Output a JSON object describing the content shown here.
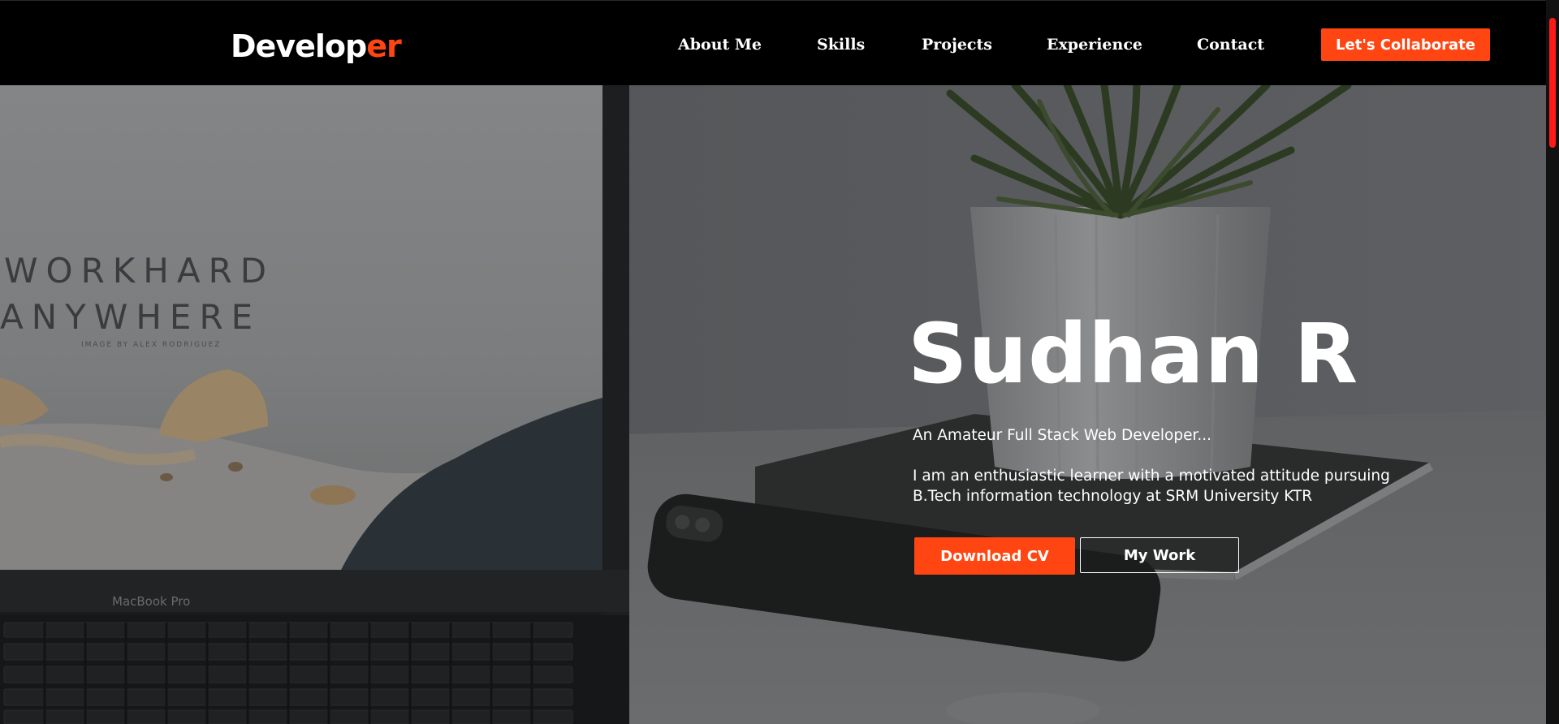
{
  "navbar": {
    "brand_main": "Develop",
    "brand_accent": "er",
    "links": [
      "About Me",
      "Skills",
      "Projects",
      "Experience",
      "Contact"
    ],
    "cta_label": "Let's Collaborate"
  },
  "hero": {
    "title": "Sudhan R",
    "tagline": "An Amateur Full Stack Web Developer...",
    "description": "I am an enthusiastic learner with a motivated attitude pursuing B.Tech information technology at SRM University KTR",
    "primary_button": "Download CV",
    "secondary_button": "My Work",
    "background_image": {
      "screen_line1": "WORKHARD",
      "screen_line2": "ANYWHERE",
      "screen_credit": "IMAGE BY ALEX RODRIGUEZ",
      "laptop_model": "MacBook Pro"
    }
  },
  "colors": {
    "accent": "#ff4612",
    "navbar_bg": "#000000",
    "text": "#ffffff",
    "scroll_thumb": "#ff1a1a"
  }
}
